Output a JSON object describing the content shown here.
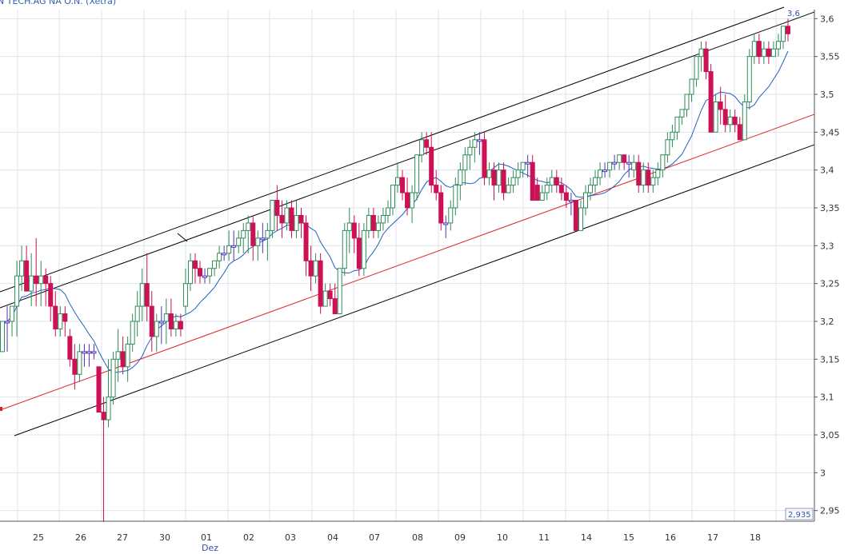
{
  "chart_data": {
    "type": "candlestick",
    "title": "N TECH.AG NA O.N. (Xetra)",
    "ylim": [
      2.93,
      3.61
    ],
    "y_ticks": [
      2.95,
      3.0,
      3.05,
      3.1,
      3.15,
      3.2,
      3.25,
      3.3,
      3.35,
      3.4,
      3.45,
      3.5,
      3.55,
      3.6
    ],
    "y_tick_labels": [
      "2,95",
      "3",
      "3,05",
      "3,1",
      "3,15",
      "3,2",
      "3,25",
      "3,3",
      "3,35",
      "3,4",
      "3,45",
      "3,5",
      "3,55",
      "3,6"
    ],
    "x_labels": [
      "25",
      "26",
      "27",
      "30",
      "01",
      "02",
      "03",
      "04",
      "07",
      "08",
      "09",
      "10",
      "11",
      "14",
      "15",
      "16",
      "17",
      "18"
    ],
    "month_label": "Dez",
    "grid": true,
    "annotations": {
      "high": "3,6",
      "low": "2,935"
    },
    "colors": {
      "up": "#2e8b57",
      "down": "#cc1155",
      "neutral": "#5030c0",
      "ma": "#2060c0",
      "regression": "#dd2222",
      "channel": "#000000",
      "grid": "#dde4ee"
    },
    "candles": [
      [
        3.16,
        3.2,
        3.2,
        3.16
      ],
      [
        3.2,
        3.22,
        3.2,
        3.16
      ],
      [
        3.2,
        3.22,
        3.22,
        3.18
      ],
      [
        3.22,
        3.28,
        3.26,
        3.18
      ],
      [
        3.26,
        3.3,
        3.28,
        3.24
      ],
      [
        3.28,
        3.3,
        3.24,
        3.24
      ],
      [
        3.24,
        3.29,
        3.26,
        3.22
      ],
      [
        3.26,
        3.31,
        3.25,
        3.22
      ],
      [
        3.25,
        3.28,
        3.26,
        3.22
      ],
      [
        3.26,
        3.27,
        3.25,
        3.22
      ],
      [
        3.25,
        3.26,
        3.22,
        3.2
      ],
      [
        3.22,
        3.24,
        3.19,
        3.18
      ],
      [
        3.19,
        3.22,
        3.21,
        3.18
      ],
      [
        3.21,
        3.22,
        3.2,
        3.18
      ],
      [
        3.18,
        3.19,
        3.15,
        3.14
      ],
      [
        3.15,
        3.17,
        3.13,
        3.11
      ],
      [
        3.13,
        3.17,
        3.16,
        3.12
      ],
      [
        3.16,
        3.17,
        3.16,
        3.14
      ],
      [
        3.16,
        3.17,
        3.16,
        3.14
      ],
      [
        3.16,
        3.17,
        3.16,
        3.15
      ],
      [
        3.14,
        3.14,
        3.08,
        3.08
      ],
      [
        3.08,
        3.1,
        3.07,
        2.935
      ],
      [
        3.07,
        3.15,
        3.1,
        3.06
      ],
      [
        3.1,
        3.16,
        3.15,
        3.09
      ],
      [
        3.15,
        3.19,
        3.16,
        3.12
      ],
      [
        3.16,
        3.18,
        3.14,
        3.13
      ],
      [
        3.14,
        3.18,
        3.17,
        3.12
      ],
      [
        3.17,
        3.21,
        3.2,
        3.16
      ],
      [
        3.2,
        3.24,
        3.22,
        3.18
      ],
      [
        3.22,
        3.27,
        3.25,
        3.2
      ],
      [
        3.25,
        3.29,
        3.22,
        3.2
      ],
      [
        3.22,
        3.24,
        3.18,
        3.16
      ],
      [
        3.18,
        3.21,
        3.2,
        3.16
      ],
      [
        3.2,
        3.22,
        3.2,
        3.17
      ],
      [
        3.2,
        3.23,
        3.21,
        3.17
      ],
      [
        3.21,
        3.23,
        3.19,
        3.18
      ],
      [
        3.19,
        3.21,
        3.2,
        3.18
      ],
      [
        3.2,
        3.21,
        3.19,
        3.18
      ],
      [
        3.22,
        3.27,
        3.25,
        3.21
      ],
      [
        3.25,
        3.29,
        3.28,
        3.24
      ],
      [
        3.28,
        3.29,
        3.27,
        3.25
      ],
      [
        3.27,
        3.28,
        3.26,
        3.25
      ],
      [
        3.26,
        3.27,
        3.26,
        3.25
      ],
      [
        3.26,
        3.27,
        3.27,
        3.25
      ],
      [
        3.27,
        3.28,
        3.28,
        3.26
      ],
      [
        3.28,
        3.3,
        3.29,
        3.27
      ],
      [
        3.29,
        3.3,
        3.29,
        3.28
      ],
      [
        3.29,
        3.32,
        3.3,
        3.28
      ],
      [
        3.3,
        3.32,
        3.3,
        3.28
      ],
      [
        3.3,
        3.32,
        3.31,
        3.29
      ],
      [
        3.31,
        3.33,
        3.32,
        3.29
      ],
      [
        3.32,
        3.34,
        3.33,
        3.29
      ],
      [
        3.33,
        3.34,
        3.3,
        3.28
      ],
      [
        3.3,
        3.32,
        3.31,
        3.28
      ],
      [
        3.31,
        3.33,
        3.31,
        3.29
      ],
      [
        3.31,
        3.33,
        3.32,
        3.28
      ],
      [
        3.32,
        3.34,
        3.36,
        3.31
      ],
      [
        3.36,
        3.38,
        3.34,
        3.32
      ],
      [
        3.34,
        3.36,
        3.33,
        3.31
      ],
      [
        3.33,
        3.36,
        3.35,
        3.32
      ],
      [
        3.35,
        3.36,
        3.32,
        3.31
      ],
      [
        3.32,
        3.36,
        3.34,
        3.31
      ],
      [
        3.34,
        3.35,
        3.33,
        3.31
      ],
      [
        3.33,
        3.34,
        3.28,
        3.26
      ],
      [
        3.28,
        3.3,
        3.26,
        3.24
      ],
      [
        3.26,
        3.29,
        3.28,
        3.25
      ],
      [
        3.28,
        3.29,
        3.22,
        3.21
      ],
      [
        3.22,
        3.25,
        3.24,
        3.22
      ],
      [
        3.24,
        3.25,
        3.23,
        3.22
      ],
      [
        3.23,
        3.25,
        3.21,
        3.21
      ],
      [
        3.21,
        3.26,
        3.27,
        3.21
      ],
      [
        3.27,
        3.33,
        3.32,
        3.26
      ],
      [
        3.32,
        3.35,
        3.33,
        3.29
      ],
      [
        3.33,
        3.34,
        3.31,
        3.29
      ],
      [
        3.31,
        3.33,
        3.27,
        3.26
      ],
      [
        3.27,
        3.33,
        3.32,
        3.26
      ],
      [
        3.32,
        3.35,
        3.34,
        3.31
      ],
      [
        3.34,
        3.35,
        3.32,
        3.31
      ],
      [
        3.32,
        3.34,
        3.33,
        3.31
      ],
      [
        3.33,
        3.35,
        3.34,
        3.32
      ],
      [
        3.34,
        3.36,
        3.35,
        3.33
      ],
      [
        3.35,
        3.38,
        3.38,
        3.34
      ],
      [
        3.38,
        3.41,
        3.39,
        3.37
      ],
      [
        3.39,
        3.4,
        3.37,
        3.36
      ],
      [
        3.37,
        3.39,
        3.35,
        3.34
      ],
      [
        3.35,
        3.38,
        3.37,
        3.33
      ],
      [
        3.37,
        3.42,
        3.42,
        3.36
      ],
      [
        3.42,
        3.45,
        3.44,
        3.41
      ],
      [
        3.44,
        3.45,
        3.43,
        3.42
      ],
      [
        3.43,
        3.45,
        3.38,
        3.37
      ],
      [
        3.38,
        3.4,
        3.37,
        3.36
      ],
      [
        3.37,
        3.38,
        3.33,
        3.32
      ],
      [
        3.33,
        3.34,
        3.33,
        3.31
      ],
      [
        3.33,
        3.36,
        3.35,
        3.32
      ],
      [
        3.35,
        3.39,
        3.38,
        3.34
      ],
      [
        3.38,
        3.41,
        3.4,
        3.36
      ],
      [
        3.4,
        3.43,
        3.42,
        3.38
      ],
      [
        3.42,
        3.44,
        3.43,
        3.4
      ],
      [
        3.43,
        3.45,
        3.44,
        3.41
      ],
      [
        3.44,
        3.45,
        3.44,
        3.42
      ],
      [
        3.44,
        3.45,
        3.39,
        3.38
      ],
      [
        3.39,
        3.41,
        3.4,
        3.38
      ],
      [
        3.4,
        3.41,
        3.38,
        3.36
      ],
      [
        3.38,
        3.41,
        3.4,
        3.37
      ],
      [
        3.4,
        3.41,
        3.37,
        3.36
      ],
      [
        3.37,
        3.39,
        3.38,
        3.37
      ],
      [
        3.38,
        3.4,
        3.39,
        3.37
      ],
      [
        3.39,
        3.41,
        3.4,
        3.38
      ],
      [
        3.4,
        3.41,
        3.41,
        3.39
      ],
      [
        3.41,
        3.42,
        3.41,
        3.39
      ],
      [
        3.41,
        3.42,
        3.36,
        3.36
      ],
      [
        3.38,
        3.39,
        3.36,
        3.36
      ],
      [
        3.36,
        3.38,
        3.37,
        3.36
      ],
      [
        3.37,
        3.39,
        3.38,
        3.36
      ],
      [
        3.38,
        3.4,
        3.39,
        3.37
      ],
      [
        3.39,
        3.4,
        3.38,
        3.37
      ],
      [
        3.38,
        3.39,
        3.37,
        3.36
      ],
      [
        3.37,
        3.38,
        3.36,
        3.35
      ],
      [
        3.36,
        3.37,
        3.36,
        3.34
      ],
      [
        3.36,
        3.36,
        3.32,
        3.32
      ],
      [
        3.32,
        3.36,
        3.35,
        3.32
      ],
      [
        3.35,
        3.38,
        3.37,
        3.34
      ],
      [
        3.37,
        3.39,
        3.38,
        3.36
      ],
      [
        3.38,
        3.4,
        3.39,
        3.37
      ],
      [
        3.39,
        3.41,
        3.4,
        3.38
      ],
      [
        3.4,
        3.41,
        3.4,
        3.39
      ],
      [
        3.4,
        3.41,
        3.41,
        3.39
      ],
      [
        3.41,
        3.42,
        3.41,
        3.4
      ],
      [
        3.41,
        3.42,
        3.42,
        3.4
      ],
      [
        3.42,
        3.42,
        3.41,
        3.4
      ],
      [
        3.41,
        3.42,
        3.41,
        3.39
      ],
      [
        3.4,
        3.42,
        3.41,
        3.39
      ],
      [
        3.41,
        3.42,
        3.38,
        3.37
      ],
      [
        3.38,
        3.41,
        3.4,
        3.37
      ],
      [
        3.4,
        3.41,
        3.38,
        3.37
      ],
      [
        3.38,
        3.4,
        3.39,
        3.37
      ],
      [
        3.39,
        3.41,
        3.4,
        3.38
      ],
      [
        3.4,
        3.42,
        3.42,
        3.39
      ],
      [
        3.42,
        3.45,
        3.44,
        3.41
      ],
      [
        3.44,
        3.46,
        3.45,
        3.43
      ],
      [
        3.45,
        3.47,
        3.47,
        3.44
      ],
      [
        3.47,
        3.48,
        3.48,
        3.46
      ],
      [
        3.48,
        3.5,
        3.5,
        3.47
      ],
      [
        3.5,
        3.52,
        3.52,
        3.49
      ],
      [
        3.52,
        3.55,
        3.55,
        3.51
      ],
      [
        3.55,
        3.57,
        3.56,
        3.53
      ],
      [
        3.56,
        3.57,
        3.53,
        3.52
      ],
      [
        3.53,
        3.54,
        3.45,
        3.45
      ],
      [
        3.45,
        3.5,
        3.49,
        3.45
      ],
      [
        3.49,
        3.51,
        3.48,
        3.46
      ],
      [
        3.48,
        3.5,
        3.46,
        3.45
      ],
      [
        3.46,
        3.48,
        3.47,
        3.45
      ],
      [
        3.47,
        3.48,
        3.46,
        3.45
      ],
      [
        3.46,
        3.47,
        3.44,
        3.44
      ],
      [
        3.44,
        3.5,
        3.49,
        3.44
      ],
      [
        3.49,
        3.56,
        3.55,
        3.48
      ],
      [
        3.55,
        3.58,
        3.57,
        3.54
      ],
      [
        3.57,
        3.58,
        3.55,
        3.54
      ],
      [
        3.55,
        3.57,
        3.56,
        3.54
      ],
      [
        3.56,
        3.57,
        3.55,
        3.54
      ],
      [
        3.55,
        3.57,
        3.56,
        3.55
      ],
      [
        3.56,
        3.58,
        3.57,
        3.55
      ],
      [
        3.57,
        3.59,
        3.59,
        3.56
      ],
      [
        3.59,
        3.6,
        3.58,
        3.57
      ]
    ]
  }
}
